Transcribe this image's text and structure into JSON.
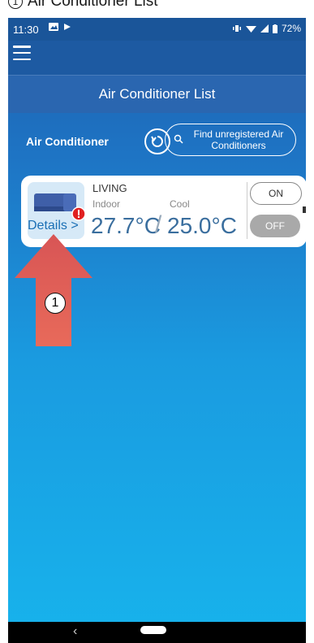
{
  "caption": {
    "number": "1",
    "text": "Air Conditioner List"
  },
  "status_bar": {
    "time": "11:30",
    "battery": "72%"
  },
  "header": {
    "title": "Air Conditioner List"
  },
  "ac_section": {
    "label": "Air Conditioner",
    "find_button": "Find unregistered Air Conditioners"
  },
  "units": [
    {
      "name": "LIVING",
      "indoor_label": "Indoor",
      "mode_label": "Cool",
      "indoor_temp": "27.7°C",
      "set_temp": "25.0°C",
      "details_link": "Details >",
      "on_label": "ON",
      "off_label": "OFF"
    }
  ],
  "callout": {
    "number": "1"
  },
  "colors": {
    "brand_blue": "#1d5aa2",
    "accent_red": "#e05050",
    "alert": "#e02020"
  }
}
